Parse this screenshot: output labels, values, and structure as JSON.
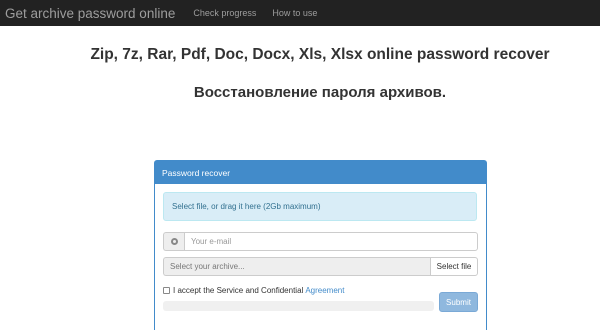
{
  "navbar": {
    "brand": "Get archive password online",
    "links": [
      "Check progress",
      "How to use"
    ]
  },
  "headings": {
    "title": "Zip, 7z, Rar, Pdf, Doc, Docx, Xls, Xlsx online password recover",
    "subtitle": "Восстановление пароля архивов."
  },
  "panel": {
    "title": "Password recover",
    "dropzone_text": "Select file, or drag it here (2Gb maximum)",
    "email_placeholder": "Your e-mail",
    "email_icon": "at-icon",
    "file_placeholder": "Select your archive...",
    "select_file_label": "Select file",
    "agreement_text": "I accept the Service and Confidential",
    "agreement_link": "Agreement",
    "agreement_checked": false,
    "submit_label": "Submit",
    "upload_progress": 0
  },
  "colors": {
    "navbar_bg": "#222222",
    "primary": "#428bca",
    "info_bg": "#d9edf7",
    "info_text": "#31708f"
  }
}
